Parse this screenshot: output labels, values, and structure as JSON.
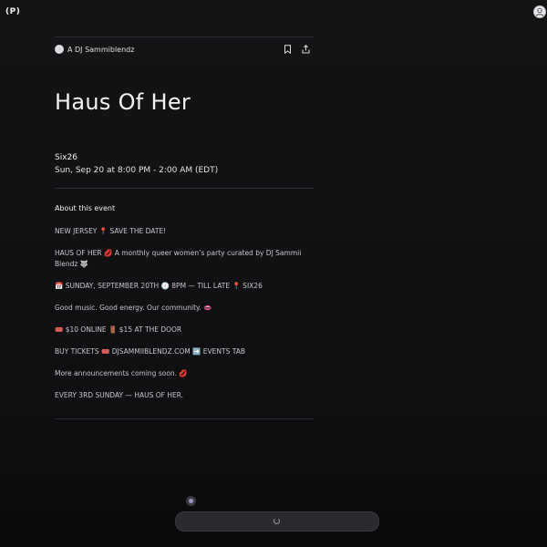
{
  "app": {
    "logo_text": "(P)",
    "account_icon": "user-icon"
  },
  "host": {
    "name": "A DJ Sammiblendz",
    "actions": [
      "bookmark-icon",
      "share-icon"
    ]
  },
  "event": {
    "title": "Haus Of Her",
    "venue": "Six26",
    "datetime": "Sun, Sep 20 at 8:00 PM - 2:00 AM (EDT)"
  },
  "about": {
    "heading": "About this event",
    "lines": [
      "NEW JERSEY 📍 SAVE THE DATE!",
      "HAUS OF HER 💋 A monthly queer women’s party curated by DJ Sammii Blendz 🐺",
      "📅 SUNDAY, SEPTEMBER 20TH 🕗 8PM — TILL LATE 📍 SIX26",
      "Good music. Good energy. Our community. 👄",
      "🎟️ $10 ONLINE 🚪 $15 AT THE DOOR",
      "BUY TICKETS 🎟️ DJSAMMIIBLENDZ.COM ➡️ EVENTS TAB",
      "More announcements coming soon. 💋",
      "EVERY 3RD SUNDAY — HAUS OF HER."
    ]
  },
  "bottom": {
    "state": "loading"
  }
}
